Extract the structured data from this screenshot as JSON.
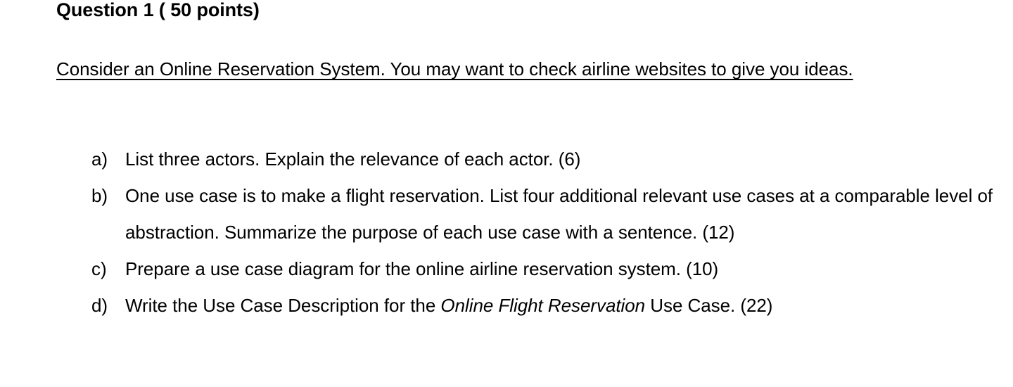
{
  "document": {
    "heading": "Question 1 ( 50 points)",
    "intro": {
      "underlined_text": "Consider an Online Reservation System. You may want to check airline websites to give you ideas."
    },
    "questions": [
      {
        "marker": "a)",
        "text": "List three actors. Explain the relevance of each actor. (6)",
        "points": "(6)"
      },
      {
        "marker": "b)",
        "text": "One use case is to make a flight reservation. List four additional relevant use cases at a comparable level of abstraction. Summarize the purpose of each use case with a sentence. (12)",
        "points": "(12)"
      },
      {
        "marker": "c)",
        "text": "Prepare a use case diagram for the online airline reservation system. (10)",
        "points": "(10)"
      },
      {
        "marker": "d)",
        "text_before_italic": "Write the Use Case Description for the ",
        "italic_text": "Online Flight Reservation",
        "text_after_italic": " Use Case. (22)",
        "points": "(22)"
      }
    ]
  },
  "colors": {
    "background": "#ffffff",
    "text": "#000000"
  }
}
